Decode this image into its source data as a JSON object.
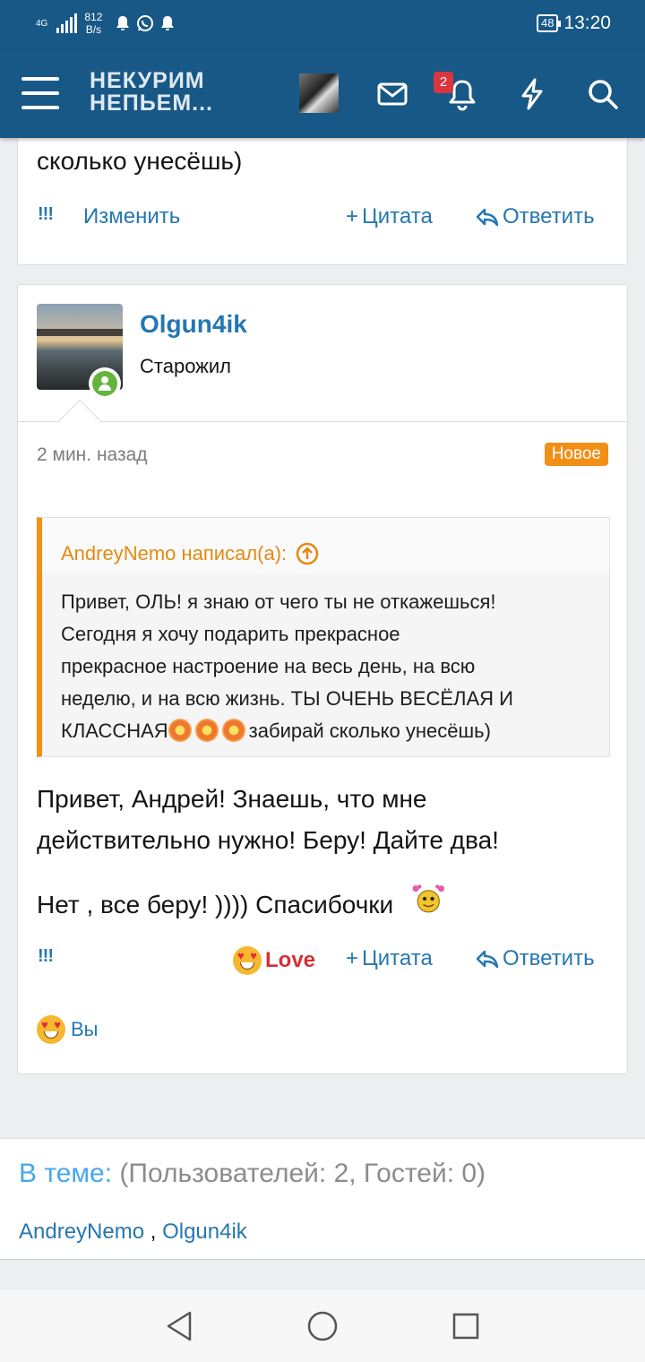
{
  "status_bar": {
    "network": "4G",
    "speed_value": "812",
    "speed_unit": "B/s",
    "battery": "48",
    "time": "13:20"
  },
  "header": {
    "logo_line1": "НЕКУРИМ",
    "logo_line2": "НЕПЬЕМ...",
    "notification_count": "2",
    "icons": [
      "menu-icon",
      "avatar",
      "mail-icon",
      "bell-icon",
      "lightning-icon",
      "search-icon"
    ]
  },
  "prev_post": {
    "tail_text": "сколько унесёшь)",
    "bang": "!!!",
    "edit_label": "Изменить",
    "quote_label": "Цитата",
    "reply_label": "Ответить"
  },
  "post": {
    "username": "Olgun4ik",
    "user_title": "Старожил",
    "time": "2 мин. назад",
    "new_badge": "Новое",
    "quote": {
      "author": "AndreyNemo написал(а):",
      "line1": "Привет, ОЛЬ! я знаю от чего ты не откажешься!",
      "line2": "Сегодня я хочу подарить прекрасное",
      "line3": "прекрасное настроение на весь день, на всю",
      "line4": "неделю, и на всю жизнь. ТЫ ОЧЕНЬ ВЕСЁЛАЯ И",
      "line5_start": "КЛАССНАЯ",
      "line5_end": "забирай сколько унесёшь)"
    },
    "message_line1": "Привет, Андрей! Знаешь, что мне",
    "message_line2": "действительно нужно! Беру! Дайте два!",
    "message_line3": "Нет , все беру! )))) Спасибочки",
    "bang": "!!!",
    "reaction_label": "Love",
    "quote_label": "Цитата",
    "reply_label": "Ответить",
    "reactors": "Вы"
  },
  "online": {
    "label": "В теме:",
    "stats": "(Пользователей: 2, Гостей: 0)",
    "user1": "AndreyNemo",
    "separator": " , ",
    "user2": "Olgun4ik"
  },
  "colors": {
    "header": "#185886",
    "link": "#2577b1",
    "accent": "#f29112",
    "love": "#d42f34",
    "badge": "#d9363e"
  }
}
